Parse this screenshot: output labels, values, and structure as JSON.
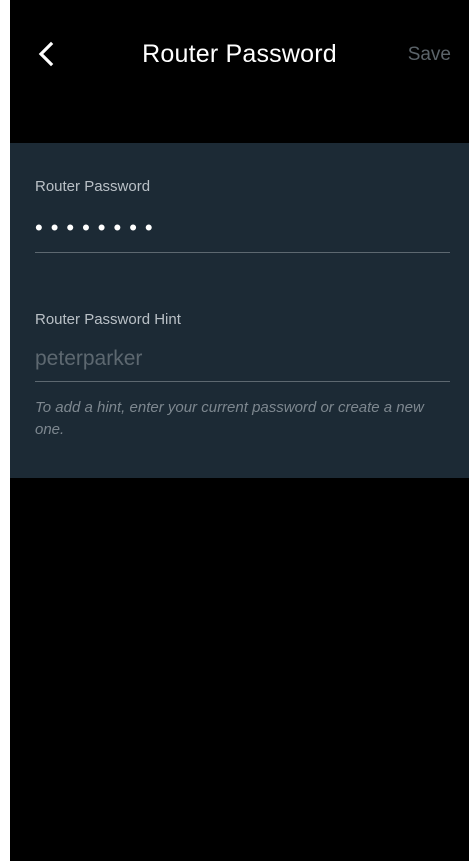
{
  "header": {
    "back_icon": "chevron-left-icon",
    "title": "Router Password",
    "save_label": "Save"
  },
  "form": {
    "password": {
      "label": "Router Password",
      "value": "••••••••"
    },
    "hint": {
      "label": "Router Password Hint",
      "placeholder": "peterparker"
    },
    "helper_text": "To add a hint, enter your current password or create a new one."
  },
  "colors": {
    "background": "#000000",
    "panel": "#1c2a35",
    "save_disabled": "#5b6369",
    "divider": "#5d6870"
  }
}
